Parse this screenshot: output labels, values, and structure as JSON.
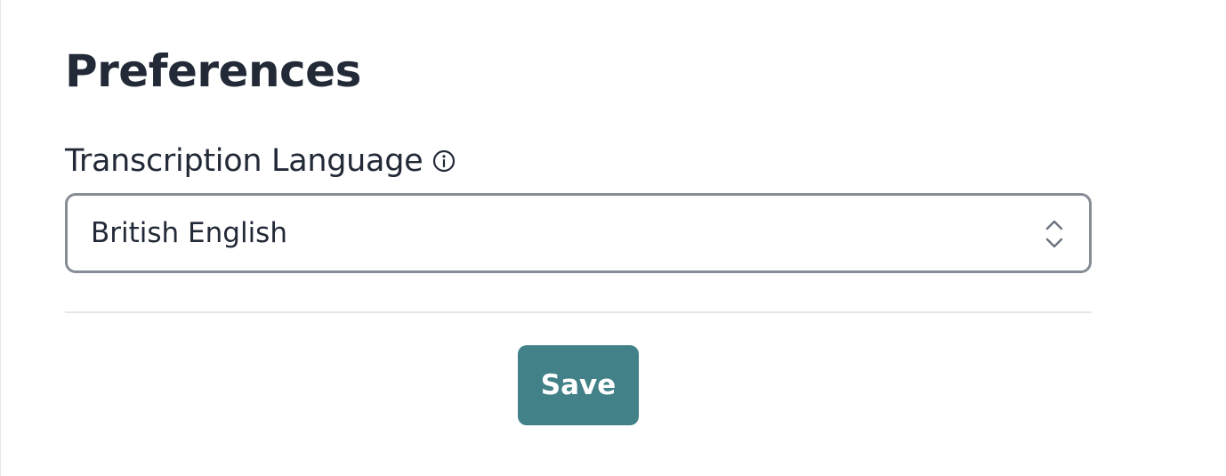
{
  "page": {
    "title": "Preferences"
  },
  "transcription_language": {
    "label": "Transcription Language",
    "info_icon": "info-circle-icon",
    "selected_value": "British English",
    "chevron_icon": "up-down-chevron-icon"
  },
  "actions": {
    "save_label": "Save"
  },
  "colors": {
    "primary_button": "#418187",
    "select_border": "#878d96",
    "text": "#222a37",
    "divider": "#e5e7eb"
  }
}
